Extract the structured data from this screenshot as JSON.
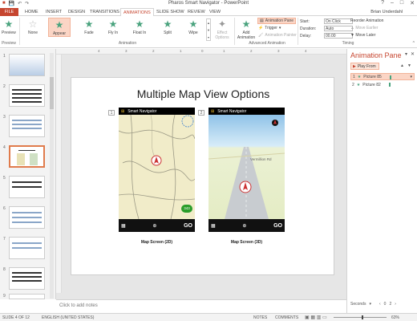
{
  "window": {
    "title": "Pharos Smart Navigator - PowerPoint",
    "user": "Brian Underdahl",
    "controls": [
      "?",
      "–",
      "□",
      "✕"
    ]
  },
  "tabs": [
    {
      "label": "FILE"
    },
    {
      "label": "HOME"
    },
    {
      "label": "INSERT"
    },
    {
      "label": "DESIGN"
    },
    {
      "label": "TRANSITIONS"
    },
    {
      "label": "ANIMATIONS"
    },
    {
      "label": "SLIDE SHOW"
    },
    {
      "label": "REVIEW"
    },
    {
      "label": "VIEW"
    }
  ],
  "ribbon": {
    "preview": {
      "label": "Preview",
      "group": "Preview"
    },
    "animations": [
      {
        "label": "None"
      },
      {
        "label": "Appear"
      },
      {
        "label": "Fade"
      },
      {
        "label": "Fly In"
      },
      {
        "label": "Float In"
      },
      {
        "label": "Split"
      },
      {
        "label": "Wipe"
      }
    ],
    "animation_group": "Animation",
    "effect_options": "Effect Options",
    "add_animation": "Add Animation",
    "advanced": {
      "group": "Advanced Animation",
      "animation_pane": "Animation Pane",
      "trigger": "Trigger",
      "animation_painter": "Animation Painter"
    },
    "timing": {
      "group": "Timing",
      "start_label": "Start:",
      "start_value": "On Click",
      "duration_label": "Duration:",
      "duration_value": "Auto",
      "delay_label": "Delay:",
      "delay_value": "00.00"
    },
    "reorder": {
      "title": "Reorder Animation",
      "earlier": "Move Earlier",
      "later": "Move Later"
    }
  },
  "ruler": {
    "h_marks": [
      "4",
      "3",
      "2",
      "1",
      "0",
      "1",
      "2",
      "3",
      "4"
    ]
  },
  "slides": [
    {
      "num": "1"
    },
    {
      "num": "2"
    },
    {
      "num": "3"
    },
    {
      "num": "4"
    },
    {
      "num": "5"
    },
    {
      "num": "6"
    },
    {
      "num": "7"
    },
    {
      "num": "8"
    },
    {
      "num": "9"
    }
  ],
  "slide": {
    "title": "Multiple Map View Options",
    "phone_left": {
      "app": "Smart Navigator",
      "caption": "Map Screen (2D)",
      "anim_tag": "1",
      "badge": "343",
      "go": "GO"
    },
    "phone_right": {
      "app": "Smart Navigator",
      "caption": "Map Screen (3D)",
      "anim_tag": "2",
      "road_label": "Vermillion Rd",
      "go": "GO"
    }
  },
  "notes_placeholder": "Click to add notes",
  "animation_pane": {
    "title": "Animation Pane",
    "play_from": "Play From",
    "items": [
      {
        "num": "1",
        "label": "Picture 85"
      },
      {
        "num": "2",
        "label": "Picture 82"
      }
    ],
    "seconds_label": "Seconds",
    "seconds_ticks": [
      "0",
      "2"
    ]
  },
  "statusbar": {
    "slide_info": "SLIDE 4 OF 12",
    "language": "ENGLISH (UNITED STATES)",
    "notes": "NOTES",
    "comments": "COMMENTS",
    "zoom": "63%"
  }
}
